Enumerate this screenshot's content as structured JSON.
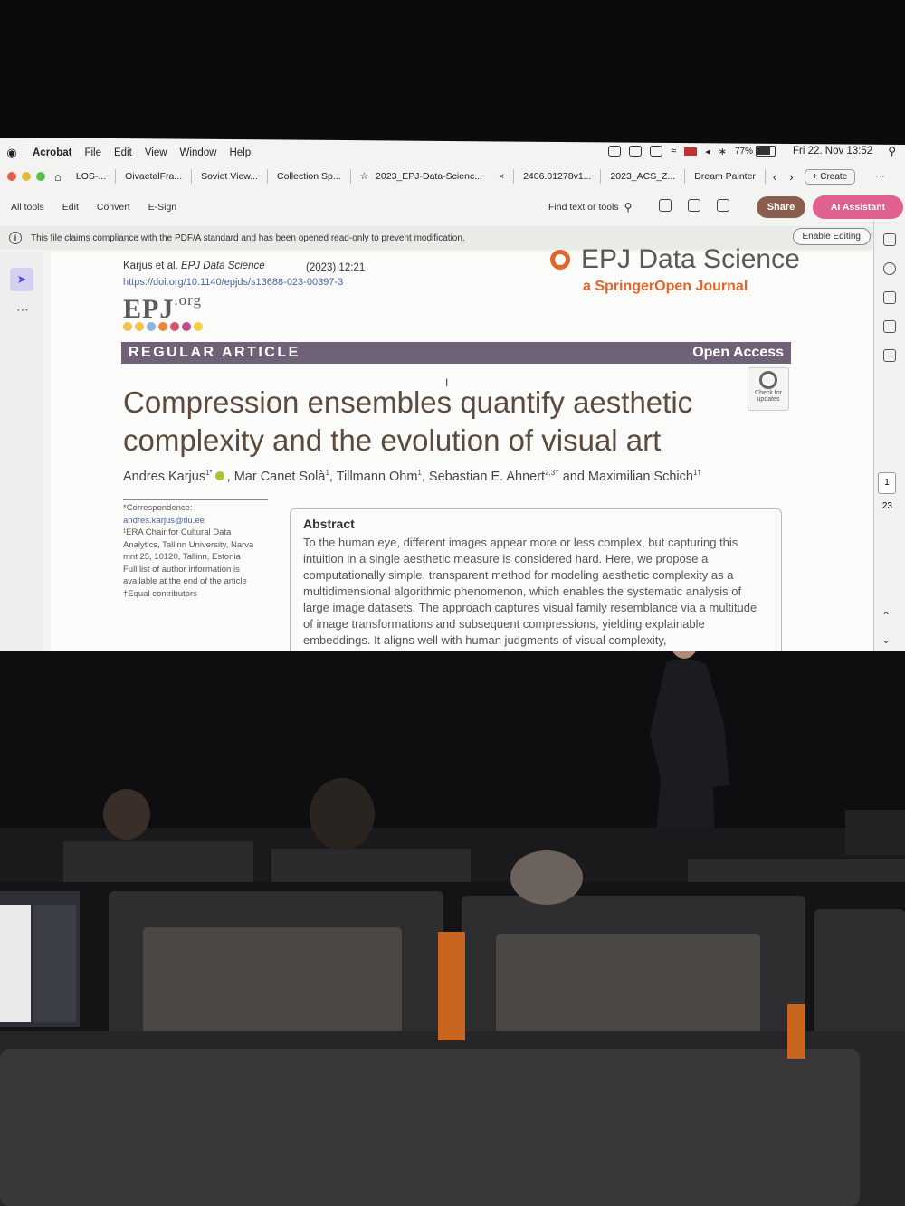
{
  "menubar": {
    "app": "Acrobat",
    "items": [
      "File",
      "Edit",
      "View",
      "Window",
      "Help"
    ],
    "battery": "77%",
    "datetime": "Fri 22. Nov  13:52"
  },
  "tabs": [
    "LOS-...",
    "OivaetalFra...",
    "Soviet View...",
    "Collection Sp...",
    "2023_EPJ-Data-Scienc...",
    "2406.01278v1...",
    "2023_ACS_Z...",
    "Dream Painter"
  ],
  "tab_close": "×",
  "create_label": "Create",
  "toolbar": {
    "items": [
      "All tools",
      "Edit",
      "Convert",
      "E-Sign"
    ],
    "find": "Find text or tools",
    "share": "Share",
    "ai": "AI Assistant"
  },
  "notice": {
    "text": "This file claims compliance with the PDF/A standard and has been opened read-only to prevent modification.",
    "button": "Enable Editing"
  },
  "pager": {
    "current": "1",
    "total": "23"
  },
  "paper": {
    "citation_authors": "Karjus et al.",
    "citation_journal": "EPJ Data Science",
    "year": "(2023)  12:21",
    "doi": "https://doi.org/10.1140/epjds/s13688-023-00397-3",
    "logo": "EPJ",
    "logo_suffix": ".org",
    "journal": "EPJ Data Science",
    "publisher": "a SpringerOpen Journal",
    "article_type": "REGULAR ARTICLE",
    "access": "Open Access",
    "check_updates": "Check for updates",
    "title": "Compression ensembles quantify aesthetic complexity and the evolution of visual art",
    "authors": [
      {
        "name": "Andres Karjus",
        "sup": "1*"
      },
      {
        "name": ", Mar Canet Solà",
        "sup": "1"
      },
      {
        "name": ", Tillmann Ohm",
        "sup": "1"
      },
      {
        "name": ", Sebastian E. Ahnert",
        "sup": "2,3†"
      },
      {
        "name": " and Maximilian Schich",
        "sup": "1†"
      }
    ],
    "correspondence_label": "*Correspondence:",
    "email": "andres.karjus@tlu.ee",
    "affiliation": "¹ERA Chair for Cultural Data Analytics, Tallinn University, Narva mnt 25, 10120, Tallinn, Estonia",
    "author_info": "Full list of author information is available at the end of the article",
    "equal": "†Equal contributors",
    "abstract_heading": "Abstract",
    "abstract_text": "To the human eye, different images appear more or less complex, but capturing this intuition in a single aesthetic measure is considered hard. Here, we propose a computationally simple, transparent method for modeling aesthetic complexity as a multidimensional algorithmic phenomenon, which enables the systematic analysis of large image datasets. The approach captures visual family resemblance via a multitude of image transformations and subsequent compressions, yielding explainable embeddings. It aligns well with human judgments of visual complexity,"
  },
  "colors": {
    "article_bar": "#6e6178",
    "springer_orange": "#e0662d",
    "title_brown": "#5b4a3d",
    "share": "#8a5e4e",
    "ai": "#e0608f"
  }
}
